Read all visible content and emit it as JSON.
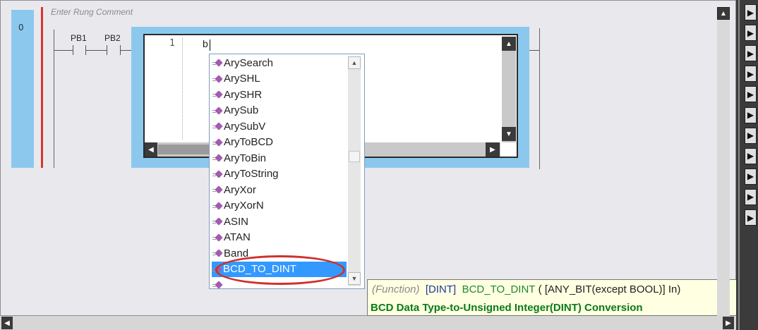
{
  "rung": {
    "number": "0",
    "comment_placeholder": "Enter Rung Comment",
    "contacts": [
      "PB1",
      "PB2"
    ]
  },
  "st_editor": {
    "line_number": "1",
    "typed_text": "b"
  },
  "autocomplete": {
    "items": [
      {
        "label": "ArySearch"
      },
      {
        "label": "ArySHL"
      },
      {
        "label": "ArySHR"
      },
      {
        "label": "ArySub"
      },
      {
        "label": "ArySubV"
      },
      {
        "label": "AryToBCD"
      },
      {
        "label": "AryToBin"
      },
      {
        "label": "AryToString"
      },
      {
        "label": "AryXor"
      },
      {
        "label": "AryXorN"
      },
      {
        "label": "ASIN"
      },
      {
        "label": "ATAN"
      },
      {
        "label": "Band"
      },
      {
        "label": "BCD_TO_DINT",
        "selected": true
      },
      {
        "label": ""
      }
    ],
    "item_icon": "function-icon"
  },
  "tooltip": {
    "kind": "(Function)",
    "return_type": "[DINT]",
    "name": "BCD_TO_DINT",
    "args": "( [ANY_BIT(except BOOL)] In)",
    "description": "BCD Data Type-to-Unsigned Integer(DINT) Conversion"
  },
  "right_toolbar": {
    "button_icon": "expand-right-icon",
    "button_count": 11
  },
  "colors": {
    "rung_highlight": "#8cc8ee",
    "left_rail": "#d9342b",
    "selection": "#3399ff",
    "annotation": "#d0302a",
    "tooltip_bg": "#ffffe1",
    "tooltip_description": "#0a7a1a"
  }
}
